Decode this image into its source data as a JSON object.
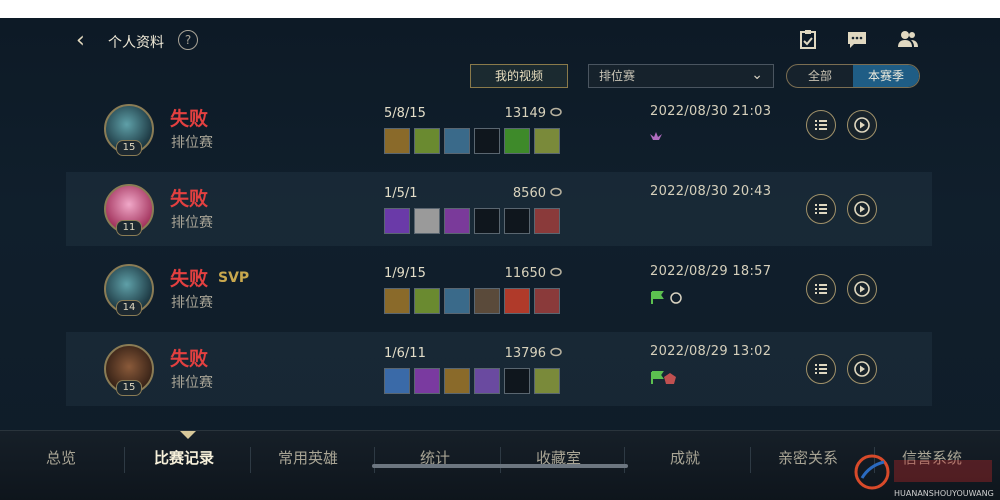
{
  "header": {
    "back_icon": "chevron-left-icon",
    "title": "个人资料",
    "help": "?"
  },
  "toolbar": {
    "video_button": "我的视频",
    "mode_select": "排位赛",
    "segment": {
      "left": "全部",
      "right": "本赛季"
    }
  },
  "matches": [
    {
      "result": "失败",
      "mode": "排位赛",
      "level": "15",
      "kda": "5/8/15",
      "gold": "13149",
      "time": "2022/08/30 21:03",
      "svp": ""
    },
    {
      "result": "失败",
      "mode": "排位赛",
      "level": "11",
      "kda": "1/5/1",
      "gold": "8560",
      "time": "2022/08/30 20:43",
      "svp": ""
    },
    {
      "result": "失败",
      "mode": "排位赛",
      "level": "14",
      "kda": "1/9/15",
      "gold": "11650",
      "time": "2022/08/29 18:57",
      "svp": "SVP"
    },
    {
      "result": "失败",
      "mode": "排位赛",
      "level": "15",
      "kda": "1/6/11",
      "gold": "13796",
      "time": "2022/08/29 13:02",
      "svp": ""
    }
  ],
  "bottom_nav": [
    "总览",
    "比赛记录",
    "常用英雄",
    "统计",
    "收藏室",
    "成就",
    "亲密关系",
    "信誉系统"
  ],
  "watermark": {
    "text": "HUANANSHOUYOUWANG"
  },
  "colors": {
    "loss": "#e34040",
    "accent": "#1f5d85",
    "gold_border": "#8a7c55"
  }
}
